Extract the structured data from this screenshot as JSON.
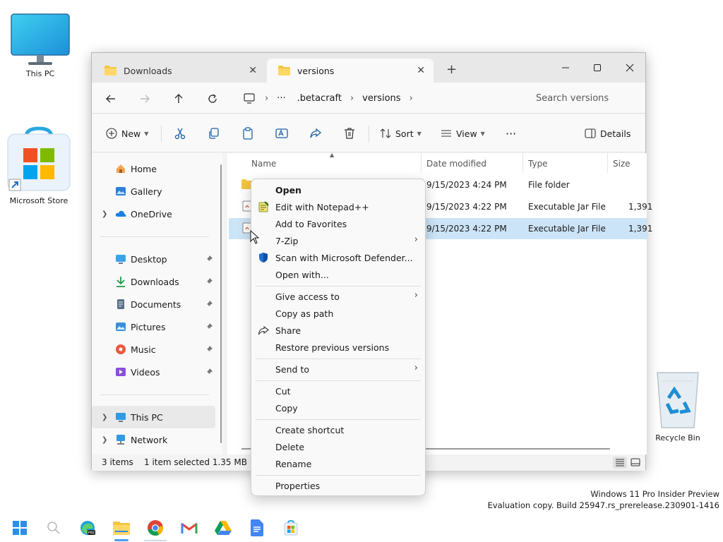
{
  "desktop": {
    "icons": [
      {
        "label": "This PC"
      },
      {
        "label": "Microsoft Store"
      },
      {
        "label": "Recycle Bin"
      }
    ],
    "watermark": {
      "line1": "Windows 11 Pro Insider Preview",
      "line2": "Evaluation copy. Build 25947.rs_prerelease.230901-1416"
    }
  },
  "window": {
    "tabs": [
      {
        "label": "Downloads",
        "active": false
      },
      {
        "label": "versions",
        "active": true
      }
    ],
    "new_tab": "+",
    "controls": {
      "minimize": "—",
      "maximize": "□",
      "close": "✕"
    }
  },
  "navbar": {
    "breadcrumbs": [
      {
        "label": "···"
      },
      {
        "label": ".betacraft"
      },
      {
        "label": "versions"
      }
    ],
    "search_placeholder": "Search versions"
  },
  "commandbar": {
    "new_label": "New",
    "sort_label": "Sort",
    "view_label": "View",
    "more_label": "···",
    "details_label": "Details"
  },
  "sidebar": {
    "home": "Home",
    "gallery": "Gallery",
    "onedrive": "OneDrive",
    "pinned": [
      {
        "label": "Desktop",
        "icon": "desktop-icon"
      },
      {
        "label": "Downloads",
        "icon": "download-icon"
      },
      {
        "label": "Documents",
        "icon": "document-icon"
      },
      {
        "label": "Pictures",
        "icon": "pictures-icon"
      },
      {
        "label": "Music",
        "icon": "music-icon"
      },
      {
        "label": "Videos",
        "icon": "video-icon"
      }
    ],
    "this_pc": "This PC",
    "network": "Network"
  },
  "filelist": {
    "columns": [
      "Name",
      "Date modified",
      "Type",
      "Size"
    ],
    "rows": [
      {
        "date": "9/15/2023 4:24 PM",
        "type": "File folder",
        "size": ""
      },
      {
        "date": "9/15/2023 4:22 PM",
        "type": "Executable Jar File",
        "size": "1,391"
      },
      {
        "date": "9/15/2023 4:22 PM",
        "type": "Executable Jar File",
        "size": "1,391",
        "selected": true
      }
    ]
  },
  "statusbar": {
    "items_count": "3 items",
    "selection": "1 item selected  1.35 MB"
  },
  "context_menu": {
    "group1": [
      {
        "label": "Open",
        "bold": true
      },
      {
        "label": "Edit with Notepad++",
        "icon": "notepadpp-icon"
      },
      {
        "label": "Add to Favorites"
      },
      {
        "label": "7-Zip",
        "submenu": true
      },
      {
        "label": "Scan with Microsoft Defender...",
        "icon": "defender-shield-icon"
      },
      {
        "label": "Open with..."
      }
    ],
    "group2": [
      {
        "label": "Give access to",
        "submenu": true
      },
      {
        "label": "Copy as path"
      },
      {
        "label": "Share",
        "icon": "share-icon"
      },
      {
        "label": "Restore previous versions"
      }
    ],
    "group3": [
      {
        "label": "Send to",
        "submenu": true
      }
    ],
    "group4": [
      {
        "label": "Cut"
      },
      {
        "label": "Copy"
      }
    ],
    "group5": [
      {
        "label": "Create shortcut"
      },
      {
        "label": "Delete"
      },
      {
        "label": "Rename"
      }
    ],
    "group6": [
      {
        "label": "Properties"
      }
    ],
    "submenu_glyph": "›"
  },
  "colors": {
    "accent": "#0067c0",
    "selection": "#cce4f7",
    "folder": "#f4c542"
  }
}
